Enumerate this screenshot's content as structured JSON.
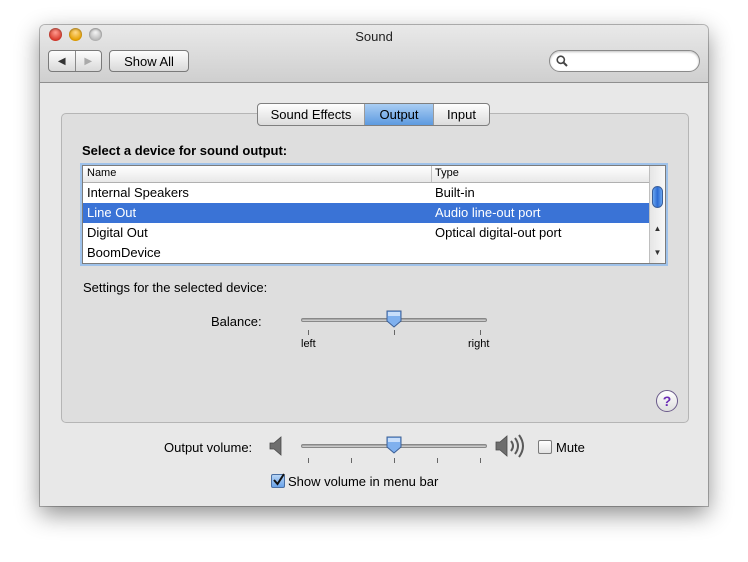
{
  "window": {
    "title": "Sound"
  },
  "toolbar": {
    "back_icon": "◀",
    "forward_icon": "▶",
    "show_all_label": "Show All",
    "search_placeholder": "",
    "search_value": ""
  },
  "tabs": [
    {
      "label": "Sound Effects",
      "active": false
    },
    {
      "label": "Output",
      "active": true
    },
    {
      "label": "Input",
      "active": false
    }
  ],
  "output": {
    "select_label": "Select a device for sound output:",
    "columns": {
      "name": "Name",
      "type": "Type"
    },
    "devices": [
      {
        "name": "Internal Speakers",
        "type": "Built-in",
        "selected": false
      },
      {
        "name": "Line Out",
        "type": "Audio line-out port",
        "selected": true
      },
      {
        "name": "Digital Out",
        "type": "Optical digital-out port",
        "selected": false
      },
      {
        "name": "BoomDevice",
        "type": "",
        "selected": false
      }
    ],
    "settings_label": "Settings for the selected device:",
    "balance": {
      "label": "Balance:",
      "left_label": "left",
      "right_label": "right",
      "value": 0.5
    }
  },
  "help_label": "?",
  "volume": {
    "label": "Output volume:",
    "value": 0.5,
    "mute_label": "Mute",
    "mute_checked": false,
    "show_in_menu_label": "Show volume in menu bar",
    "show_in_menu_checked": true
  },
  "colors": {
    "selection": "#3a73d6",
    "accent": "#5d9ae0"
  }
}
